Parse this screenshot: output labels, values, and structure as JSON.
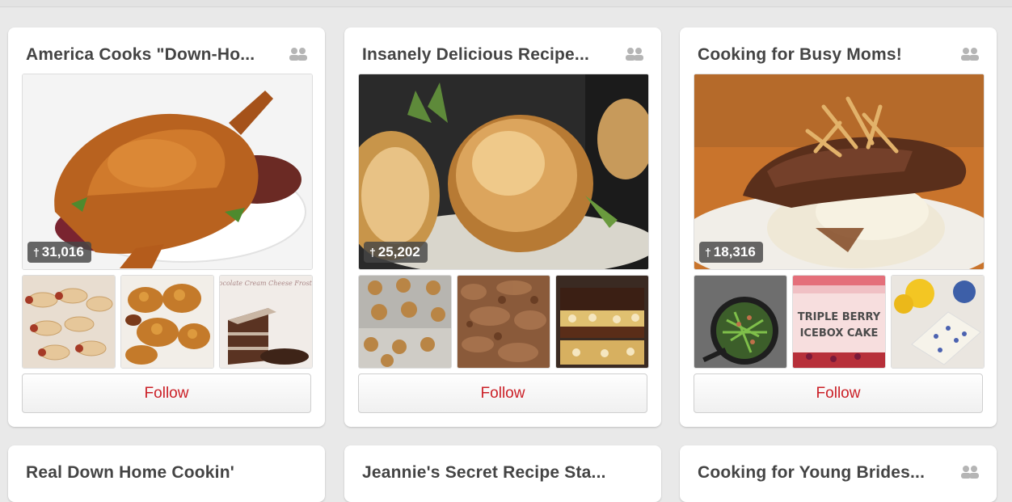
{
  "boards": [
    {
      "title": "America Cooks \"Down-Ho...",
      "pin_count": "31,016",
      "follow_label": "Follow",
      "cover_icon": "roast-turkey",
      "thumb_icons": [
        "pigs-in-blanket",
        "fried-chicken",
        "chocolate-cream-cheese-frosting-cake"
      ],
      "thumb_text": [
        "",
        "",
        "Chocolate Cream Cheese Frosting"
      ]
    },
    {
      "title": "Insanely Delicious Recipe...",
      "pin_count": "25,202",
      "follow_label": "Follow",
      "cover_icon": "seared-scallops",
      "thumb_icons": [
        "cookies-on-tray",
        "crumble-texture",
        "layered-bars"
      ],
      "thumb_text": [
        "",
        "",
        ""
      ]
    },
    {
      "title": "Cooking for Busy Moms!",
      "pin_count": "18,316",
      "follow_label": "Follow",
      "cover_icon": "pot-roast-mashed-potatoes",
      "thumb_icons": [
        "green-beans-skillet",
        "triple-berry-icebox-cake",
        "lemon-blueberry-dessert"
      ],
      "thumb_text": [
        "",
        "TRIPLE BERRY ICEBOX CAKE",
        ""
      ]
    },
    {
      "title": "Real Down Home Cookin'"
    },
    {
      "title": "Jeannie's Secret Recipe Sta..."
    },
    {
      "title": "Cooking for Young Brides..."
    }
  ],
  "colors": {
    "follow_text": "#cb2027",
    "title_text": "#444444",
    "background": "#e9e9e9"
  }
}
